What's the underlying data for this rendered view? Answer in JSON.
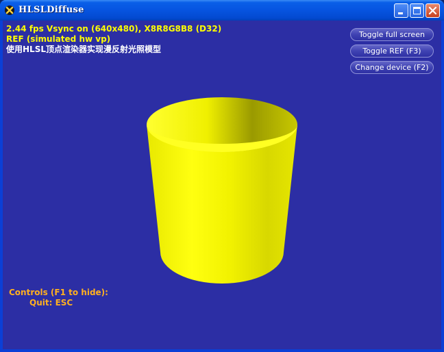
{
  "window": {
    "title": "HLSLDiffuse"
  },
  "stats": {
    "line1": "2.44 fps Vsync on (640x480), X8R8G8B8 (D32)",
    "line2": "REF (simulated hw vp)",
    "line3": "使用HLSL顶点渲染器实现漫反射光照模型"
  },
  "buttons": {
    "toggle_full_screen": "Toggle full screen",
    "toggle_ref": "Toggle REF (F3)",
    "change_device": "Change device (F2)"
  },
  "controls": {
    "heading": "Controls (F1 to hide):",
    "quit": "Quit: ESC"
  },
  "colors": {
    "background": "#2c2ea4",
    "model": "#ffff00",
    "stats_text": "#ffff00",
    "controls_text": "#ffb020"
  },
  "icons": [
    "app-icon",
    "minimize-icon",
    "maximize-icon",
    "close-icon"
  ]
}
